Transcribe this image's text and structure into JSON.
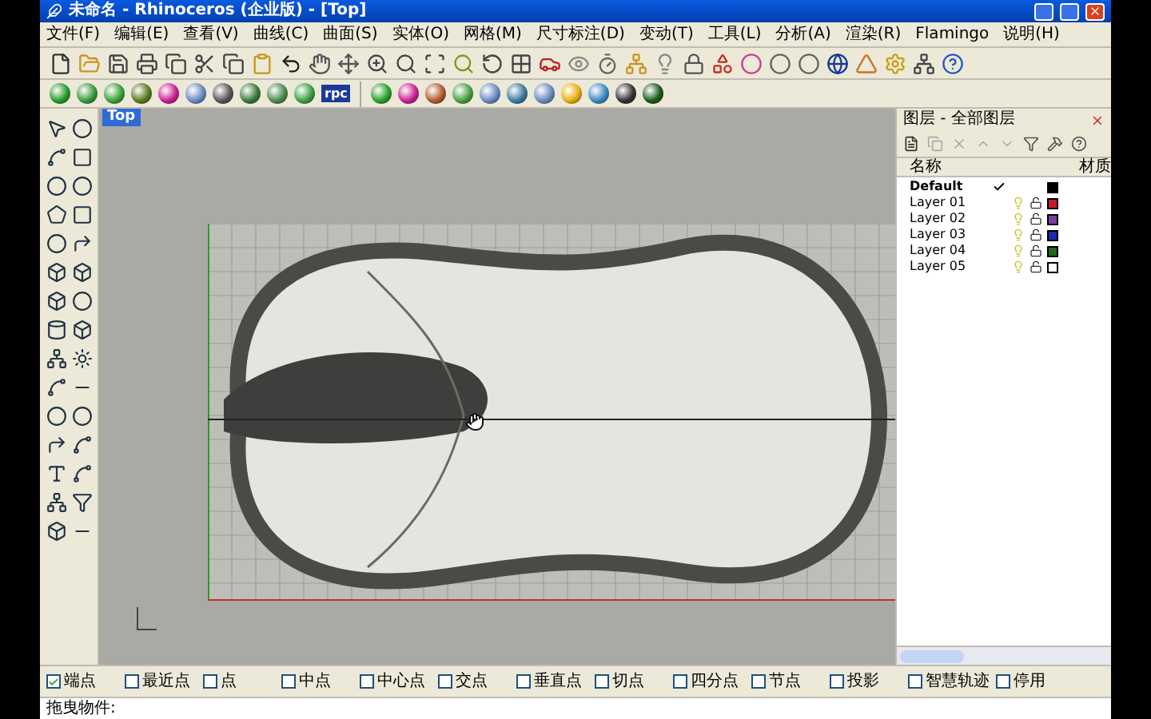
{
  "window": {
    "title": "未命名 - Rhinoceros (企业版) - [Top]"
  },
  "menu": [
    "文件(F)",
    "编辑(E)",
    "查看(V)",
    "曲线(C)",
    "曲面(S)",
    "实体(O)",
    "网格(M)",
    "尺寸标注(D)",
    "变动(T)",
    "工具(L)",
    "分析(A)",
    "渲染(R)",
    "Flamingo",
    "说明(H)"
  ],
  "render_toolbar": {
    "rpc_label": "rpc"
  },
  "viewport": {
    "title": "Top"
  },
  "layers_panel": {
    "title": "图层 - 全部图层",
    "columns": [
      "名称",
      "材质"
    ],
    "layers": [
      {
        "name": "Default",
        "current": true,
        "color": "#000000"
      },
      {
        "name": "Layer 01",
        "current": false,
        "on": true,
        "locked": false,
        "color": "#c0202a"
      },
      {
        "name": "Layer 02",
        "current": false,
        "on": true,
        "locked": false,
        "color": "#7a3fa0"
      },
      {
        "name": "Layer 03",
        "current": false,
        "on": true,
        "locked": false,
        "color": "#1a2aa8"
      },
      {
        "name": "Layer 04",
        "current": false,
        "on": true,
        "locked": false,
        "color": "#1f6a1f"
      },
      {
        "name": "Layer 05",
        "current": false,
        "on": true,
        "locked": false,
        "color": "#ffffff"
      }
    ]
  },
  "osnaps": [
    {
      "label": "端点",
      "checked": true
    },
    {
      "label": "最近点",
      "checked": false
    },
    {
      "label": "点",
      "checked": false
    },
    {
      "label": "中点",
      "checked": false
    },
    {
      "label": "中心点",
      "checked": false
    },
    {
      "label": "交点",
      "checked": false
    },
    {
      "label": "垂直点",
      "checked": false
    },
    {
      "label": "切点",
      "checked": false
    },
    {
      "label": "四分点",
      "checked": false
    },
    {
      "label": "节点",
      "checked": false
    },
    {
      "label": "投影",
      "checked": false
    },
    {
      "label": "智慧轨迹",
      "checked": false
    },
    {
      "label": "停用",
      "checked": false
    }
  ],
  "command_line": {
    "prompt": "拖曳物件:"
  }
}
